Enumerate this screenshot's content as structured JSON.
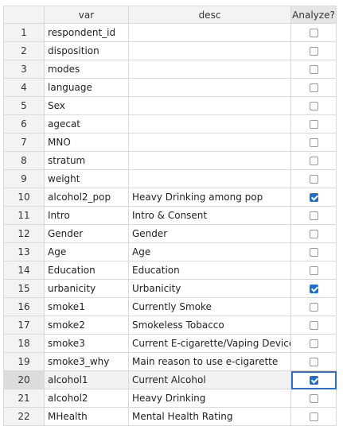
{
  "headers": {
    "index": "",
    "var": "var",
    "desc": "desc",
    "analyze": "Analyze?"
  },
  "rows": [
    {
      "n": "1",
      "var": "respondent_id",
      "desc": "",
      "checked": false
    },
    {
      "n": "2",
      "var": "disposition",
      "desc": "",
      "checked": false
    },
    {
      "n": "3",
      "var": "modes",
      "desc": "",
      "checked": false
    },
    {
      "n": "4",
      "var": "language",
      "desc": "",
      "checked": false
    },
    {
      "n": "5",
      "var": "Sex",
      "desc": "",
      "checked": false
    },
    {
      "n": "6",
      "var": "agecat",
      "desc": "",
      "checked": false
    },
    {
      "n": "7",
      "var": "MNO",
      "desc": "",
      "checked": false
    },
    {
      "n": "8",
      "var": "stratum",
      "desc": "",
      "checked": false
    },
    {
      "n": "9",
      "var": "weight",
      "desc": "",
      "checked": false
    },
    {
      "n": "10",
      "var": "alcohol2_pop",
      "desc": "Heavy Drinking among pop",
      "checked": true
    },
    {
      "n": "11",
      "var": "Intro",
      "desc": "Intro & Consent",
      "checked": false
    },
    {
      "n": "12",
      "var": "Gender",
      "desc": "Gender",
      "checked": false
    },
    {
      "n": "13",
      "var": "Age",
      "desc": "Age",
      "checked": false
    },
    {
      "n": "14",
      "var": "Education",
      "desc": "Education",
      "checked": false
    },
    {
      "n": "15",
      "var": "urbanicity",
      "desc": "Urbanicity",
      "checked": true
    },
    {
      "n": "16",
      "var": "smoke1",
      "desc": "Currently Smoke",
      "checked": false
    },
    {
      "n": "17",
      "var": "smoke2",
      "desc": "Smokeless Tobacco",
      "checked": false
    },
    {
      "n": "18",
      "var": "smoke3",
      "desc": "Current E-cigarette/Vaping Device",
      "checked": false
    },
    {
      "n": "19",
      "var": "smoke3_why",
      "desc": "Main reason to use e-cigarette",
      "checked": false
    },
    {
      "n": "20",
      "var": "alcohol1",
      "desc": "Current Alcohol",
      "checked": true,
      "selected": true
    },
    {
      "n": "21",
      "var": "alcohol2",
      "desc": "Heavy Drinking",
      "checked": false
    },
    {
      "n": "22",
      "var": "MHealth",
      "desc": "Mental Health Rating",
      "checked": false
    }
  ]
}
